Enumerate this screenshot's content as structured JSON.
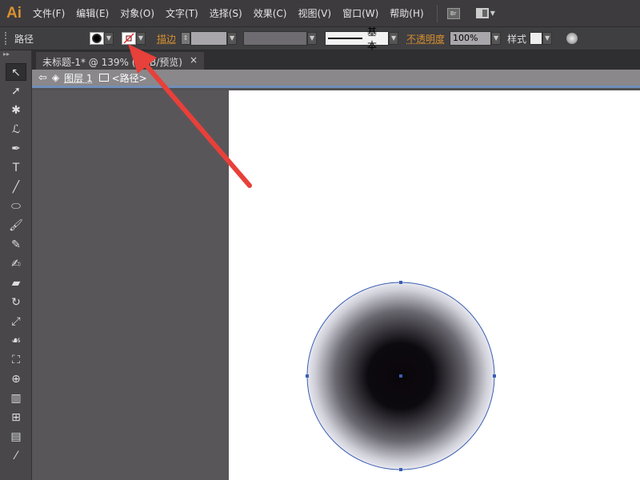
{
  "app": {
    "logo": "Ai"
  },
  "menu": [
    "文件(F)",
    "编辑(E)",
    "对象(O)",
    "文字(T)",
    "选择(S)",
    "效果(C)",
    "视图(V)",
    "窗口(W)",
    "帮助(H)"
  ],
  "bridge": "Br",
  "control": {
    "object_type": "路径",
    "stroke_label": "描边",
    "stroke_style": "基本",
    "opacity_label": "不透明度",
    "opacity_value": "100%",
    "style_label": "样式"
  },
  "document_tab": {
    "title": "未标题-1* @ 139% (RGB/预览)",
    "close": "×"
  },
  "breadcrumb": {
    "layer": "图层 1",
    "object": "<路径>"
  },
  "tools": [
    "selection",
    "direct-selection",
    "magic-wand",
    "lasso",
    "pen",
    "type",
    "line",
    "ellipse",
    "paintbrush",
    "pencil",
    "blob-brush",
    "eraser",
    "rotate",
    "scale",
    "warp",
    "free-transform",
    "shape-builder",
    "graph",
    "mesh",
    "gradient",
    "eyedropper"
  ],
  "colors": {
    "accent": "#d9902f",
    "arrow": "#e8403a",
    "selection": "#3a5fb0"
  }
}
